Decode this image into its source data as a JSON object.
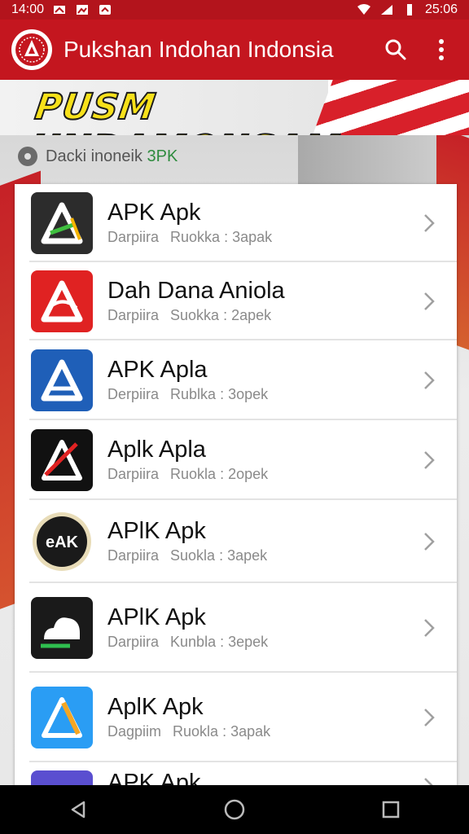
{
  "status_bar": {
    "time_left": "14:00",
    "time_right": "25:06"
  },
  "app_bar": {
    "title": "Pukshan Indohan Indonsia",
    "icons": [
      "search-icon",
      "more-vert-icon"
    ]
  },
  "banner": {
    "title": "PUSM UNDAMONSAM"
  },
  "breadcrumb": {
    "text": "Dacki inoneik ",
    "accent": "3PK"
  },
  "list": {
    "items": [
      {
        "title": "APK Apk",
        "sub1": "Darpiira",
        "sub2": "Ruokka : 3apak",
        "icon": "apk-white-a-icon",
        "color": "#2c2c2c"
      },
      {
        "title": "Dah Dana Aniola",
        "sub1": "Darpiira",
        "sub2": "Suokka : 2apek",
        "icon": "apk-red-a-icon",
        "color": "#e02222"
      },
      {
        "title": "APK Apla",
        "sub1": "Derpiira",
        "sub2": "Rublka : 3opek",
        "icon": "apk-blue-a-icon",
        "color": "#1f5fb8"
      },
      {
        "title": "Aplk Apla",
        "sub1": "Darpiira",
        "sub2": "Ruokla : 2opek",
        "icon": "apk-black-red-a-icon",
        "color": "#111111"
      },
      {
        "title": "APlK Apk",
        "sub1": "Darpiira",
        "sub2": "Suokla : 3apek",
        "icon": "apk-round-badge-icon",
        "color": "#1a1a1a"
      },
      {
        "title": "APlK Apk",
        "sub1": "Darpiira",
        "sub2": "Kunbla : 3epek",
        "icon": "apk-cloud-icon",
        "color": "#1a1a1a"
      },
      {
        "title": "AplK Apk",
        "sub1": "Dagpiim",
        "sub2": "Ruokla : 3apak",
        "icon": "apk-lightblue-a-icon",
        "color": "#2a9df4"
      },
      {
        "title": "APK Apk",
        "sub1": "",
        "sub2": "",
        "icon": "apk-purple-icon",
        "color": "#5a4fd0"
      }
    ]
  },
  "nav_bar": {
    "icons": [
      "back-icon",
      "home-icon",
      "recents-icon"
    ]
  },
  "colors": {
    "app_bar": "#c4161f",
    "status_bar": "#b3141c",
    "accent_green": "#2e8b3e"
  }
}
